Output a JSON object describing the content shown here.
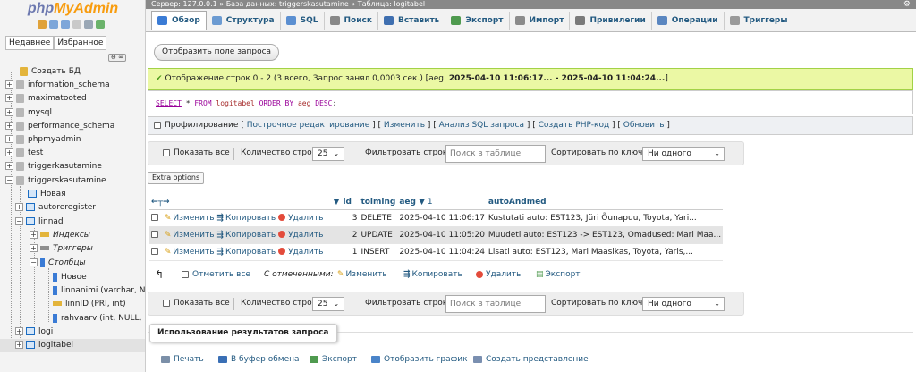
{
  "nav": {
    "logo_a": "php",
    "logo_b": "MyAdmin",
    "tab_recent": "Недавнее",
    "tab_favorites": "Избранное",
    "collapse": "⊖ ∞",
    "tree": [
      {
        "label": "Создать БД"
      },
      {
        "label": "information_schema"
      },
      {
        "label": "maximatooted"
      },
      {
        "label": "mysql"
      },
      {
        "label": "performance_schema"
      },
      {
        "label": "phpmyadmin"
      },
      {
        "label": "test"
      },
      {
        "label": "triggerkasutamine"
      },
      {
        "label": "triggerskasutamine"
      },
      {
        "label": "Новая"
      },
      {
        "label": "autoreregister"
      },
      {
        "label": "linnad"
      },
      {
        "label": "Индексы"
      },
      {
        "label": "Триггеры"
      },
      {
        "label": "Столбцы"
      },
      {
        "label": "Новое"
      },
      {
        "label": "linnanimi (varchar, NUl"
      },
      {
        "label": "linnID (PRI, int)"
      },
      {
        "label": "rahvaarv (int, NULL, nu"
      },
      {
        "label": "logi"
      },
      {
        "label": "logitabel"
      }
    ]
  },
  "topbar": {
    "breadcrumb": "Сервер: 127.0.0.1  »  База данных: triggerskasutamine  »  Таблица: logitabel"
  },
  "tabs": [
    {
      "label": "Обзор",
      "color": "#3a7bd5"
    },
    {
      "label": "Структура",
      "color": "#6c9bd2"
    },
    {
      "label": "SQL",
      "color": "#5b8fd1"
    },
    {
      "label": "Поиск",
      "color": "#888888"
    },
    {
      "label": "Вставить",
      "color": "#3f6fb0"
    },
    {
      "label": "Экспорт",
      "color": "#4f9a4f"
    },
    {
      "label": "Импорт",
      "color": "#8b8b8b"
    },
    {
      "label": "Привилегии",
      "color": "#7a7a7a"
    },
    {
      "label": "Операции",
      "color": "#5a86c0"
    },
    {
      "label": "Триггеры",
      "color": "#9a9a9a"
    }
  ],
  "show_query_button": "Отобразить поле запроса",
  "success": {
    "text": "Отображение строк 0 - 2 (3 всего, Запрос занял 0,0003 сек.) [aeg: ",
    "range": "2025-04-10 11:06:17... - 2025-04-10 11:04:24...",
    "end": "]"
  },
  "sql": {
    "select": "SELECT",
    "star": " * ",
    "from": "FROM",
    "table": " logitabel ",
    "order": "ORDER BY",
    "col": " aeg ",
    "desc": "DESC",
    "semi": ";"
  },
  "profiling": {
    "label": "Профилирование",
    "links": [
      "Построчное редактирование",
      "Изменить",
      "Анализ SQL запроса",
      "Создать PHP-код",
      "Обновить"
    ]
  },
  "controls": {
    "show_all": "Показать все",
    "rows_label": "Количество строк:",
    "rows_value": "25",
    "filter_label": "Фильтровать строки:",
    "filter_placeholder": "Поиск в таблице",
    "sort_label": "Сортировать по ключу:",
    "sort_value": "Ни одного"
  },
  "extra_options": "Extra options",
  "table": {
    "headers": {
      "id": "id",
      "toiming": "toiming",
      "aeg": "aeg",
      "aeg_sort": "▼ 1",
      "auto": "autoAndmed"
    },
    "actions": {
      "edit": "Изменить",
      "copy": "Копировать",
      "delete": "Удалить"
    },
    "rows": [
      {
        "id": "3",
        "toiming": "DELETE",
        "aeg": "2025-04-10 11:06:17",
        "auto": "Kustutati auto: EST123, Jüri Õunapuu, Toyota, Yari..."
      },
      {
        "id": "2",
        "toiming": "UPDATE",
        "aeg": "2025-04-10 11:05:20",
        "auto": "Muudeti auto: EST123 -> EST123, Omadused: Mari Maa..."
      },
      {
        "id": "1",
        "toiming": "INSERT",
        "aeg": "2025-04-10 11:04:24",
        "auto": "Lisati auto: EST123, Mari Maasikas, Toyota, Yaris,..."
      }
    ]
  },
  "bulk": {
    "check_all": "Отметить все",
    "with_selected": "С отмеченными:",
    "edit": "Изменить",
    "copy": "Копировать",
    "delete": "Удалить",
    "export": "Экспорт"
  },
  "results_ops": {
    "legend": "Использование результатов запроса",
    "print": "Печать",
    "clipboard": "В буфер обмена",
    "export": "Экспорт",
    "chart": "Отобразить график",
    "view": "Создать представление"
  }
}
